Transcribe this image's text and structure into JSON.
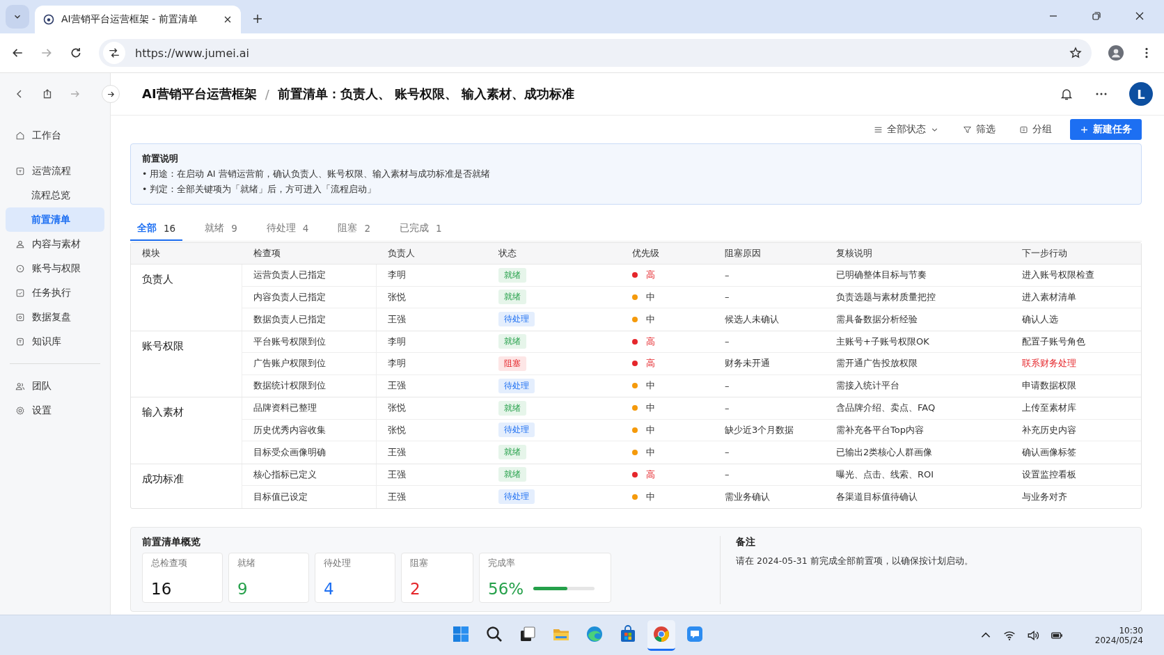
{
  "browser": {
    "tab_title": "AI营销平台运营框架 - 前置清单",
    "url": "https://www.jumei.ai"
  },
  "header": {
    "breadcrumb": [
      "AI营销平台运营框架",
      "/",
      "前置清单：负责人、 账号权限、 输入素材、成功标准"
    ],
    "avatar": "L"
  },
  "sidebar": {
    "items": [
      {
        "label": "工作台",
        "selected": false
      },
      {
        "label": "运营流程",
        "selected": false,
        "children": [
          {
            "label": "流程总览",
            "selected": false
          },
          {
            "label": "前置清单",
            "selected": true
          }
        ]
      },
      {
        "label": "内容与素材",
        "selected": false
      },
      {
        "label": "账号与权限",
        "selected": false
      },
      {
        "label": "任务执行",
        "selected": false
      },
      {
        "label": "数据复盘",
        "selected": false
      },
      {
        "label": "知识库",
        "selected": false
      }
    ],
    "footer_items": [
      {
        "label": "团队",
        "selected": false
      },
      {
        "label": "设置",
        "selected": false
      }
    ]
  },
  "toolbar": {
    "status_filter": "全部状态",
    "filter": "筛选",
    "group": "分组",
    "new_button": "新建任务"
  },
  "notice": {
    "title": "前置说明",
    "lines": [
      "• 用途：在启动 AI 营销运营前，确认负责人、账号权限、输入素材与成功标准是否就绪",
      "• 判定：全部关键项为「就绪」后，方可进入「流程启动」"
    ]
  },
  "tabs": [
    {
      "label": "全部",
      "count": "16",
      "selected": true
    },
    {
      "label": "就绪",
      "count": "9",
      "selected": false
    },
    {
      "label": "待处理",
      "count": "4",
      "selected": false
    },
    {
      "label": "阻塞",
      "count": "2",
      "selected": false
    },
    {
      "label": "已完成",
      "count": "1",
      "selected": false
    }
  ],
  "table": {
    "columns": [
      "模块",
      "检查项",
      "负责人",
      "状态",
      "优先级",
      "阻塞原因",
      "复核说明",
      "下一步行动"
    ],
    "groups": [
      {
        "module": "负责人",
        "rows": [
          {
            "item": "运营负责人已指定",
            "owner": "李明",
            "status": {
              "label": "就绪",
              "kind": "ready"
            },
            "priority": {
              "label": "高",
              "kind": "high"
            },
            "block_reason": "–",
            "note": "已明确整体目标与节奏",
            "next_action": "进入账号权限检查",
            "urgent": false
          },
          {
            "item": "内容负责人已指定",
            "owner": "张悦",
            "status": {
              "label": "就绪",
              "kind": "ready"
            },
            "priority": {
              "label": "中",
              "kind": "medium"
            },
            "block_reason": "–",
            "note": "负责选题与素材质量把控",
            "next_action": "进入素材清单",
            "urgent": false
          },
          {
            "item": "数据负责人已指定",
            "owner": "王强",
            "status": {
              "label": "待处理",
              "kind": "pending"
            },
            "priority": {
              "label": "中",
              "kind": "medium"
            },
            "block_reason": "候选人未确认",
            "note": "需具备数据分析经验",
            "next_action": "确认人选",
            "urgent": false
          }
        ]
      },
      {
        "module": "账号权限",
        "rows": [
          {
            "item": "平台账号权限到位",
            "owner": "李明",
            "status": {
              "label": "就绪",
              "kind": "ready"
            },
            "priority": {
              "label": "高",
              "kind": "high"
            },
            "block_reason": "–",
            "note": "主账号+子账号权限OK",
            "next_action": "配置子账号角色",
            "urgent": false
          },
          {
            "item": "广告账户权限到位",
            "owner": "李明",
            "status": {
              "label": "阻塞",
              "kind": "blocked"
            },
            "priority": {
              "label": "高",
              "kind": "high"
            },
            "block_reason": "财务未开通",
            "note": "需开通广告投放权限",
            "next_action": "联系财务处理",
            "urgent": true
          },
          {
            "item": "数据统计权限到位",
            "owner": "王强",
            "status": {
              "label": "待处理",
              "kind": "pending"
            },
            "priority": {
              "label": "中",
              "kind": "medium"
            },
            "block_reason": "–",
            "note": "需接入统计平台",
            "next_action": "申请数据权限",
            "urgent": false
          }
        ]
      },
      {
        "module": "输入素材",
        "rows": [
          {
            "item": "品牌资料已整理",
            "owner": "张悦",
            "status": {
              "label": "就绪",
              "kind": "ready"
            },
            "priority": {
              "label": "中",
              "kind": "medium"
            },
            "block_reason": "–",
            "note": "含品牌介绍、卖点、FAQ",
            "next_action": "上传至素材库",
            "urgent": false
          },
          {
            "item": "历史优秀内容收集",
            "owner": "张悦",
            "status": {
              "label": "待处理",
              "kind": "pending"
            },
            "priority": {
              "label": "中",
              "kind": "medium"
            },
            "block_reason": "缺少近3个月数据",
            "note": "需补充各平台Top内容",
            "next_action": "补充历史内容",
            "urgent": false
          },
          {
            "item": "目标受众画像明确",
            "owner": "王强",
            "status": {
              "label": "就绪",
              "kind": "ready"
            },
            "priority": {
              "label": "中",
              "kind": "medium"
            },
            "block_reason": "–",
            "note": "已输出2类核心人群画像",
            "next_action": "确认画像标签",
            "urgent": false
          }
        ]
      },
      {
        "module": "成功标准",
        "rows": [
          {
            "item": "核心指标已定义",
            "owner": "王强",
            "status": {
              "label": "就绪",
              "kind": "ready"
            },
            "priority": {
              "label": "高",
              "kind": "high"
            },
            "block_reason": "–",
            "note": "曝光、点击、线索、ROI",
            "next_action": "设置监控看板",
            "urgent": false
          },
          {
            "item": "目标值已设定",
            "owner": "王强",
            "status": {
              "label": "待处理",
              "kind": "pending"
            },
            "priority": {
              "label": "中",
              "kind": "medium"
            },
            "block_reason": "需业务确认",
            "note": "各渠道目标值待确认",
            "next_action": "与业务对齐",
            "urgent": false
          }
        ]
      }
    ]
  },
  "summary": {
    "title": "前置清单概览",
    "stats": [
      {
        "label": "总检查项",
        "value": "16",
        "kind": "total"
      },
      {
        "label": "就绪",
        "value": "9",
        "kind": "ready"
      },
      {
        "label": "待处理",
        "value": "4",
        "kind": "pending"
      },
      {
        "label": "阻塞",
        "value": "2",
        "kind": "blocked"
      }
    ],
    "completion": {
      "label": "完成率",
      "value": "56%",
      "level": 0.56
    }
  },
  "remarks": {
    "title": "备注",
    "text": "请在 2024-05-31 前完成全部前置项，以确保按计划启动。"
  },
  "taskbar": {
    "apps": [
      {
        "kind": "windows",
        "selected": false
      },
      {
        "kind": "search",
        "selected": false
      },
      {
        "kind": "taskview",
        "selected": false
      },
      {
        "kind": "folder",
        "selected": false
      },
      {
        "kind": "edge",
        "selected": false
      },
      {
        "kind": "store",
        "selected": false
      },
      {
        "kind": "chrome",
        "selected": true
      },
      {
        "kind": "chat",
        "selected": false
      }
    ],
    "time": "10:30",
    "date": "2024/05/24"
  }
}
